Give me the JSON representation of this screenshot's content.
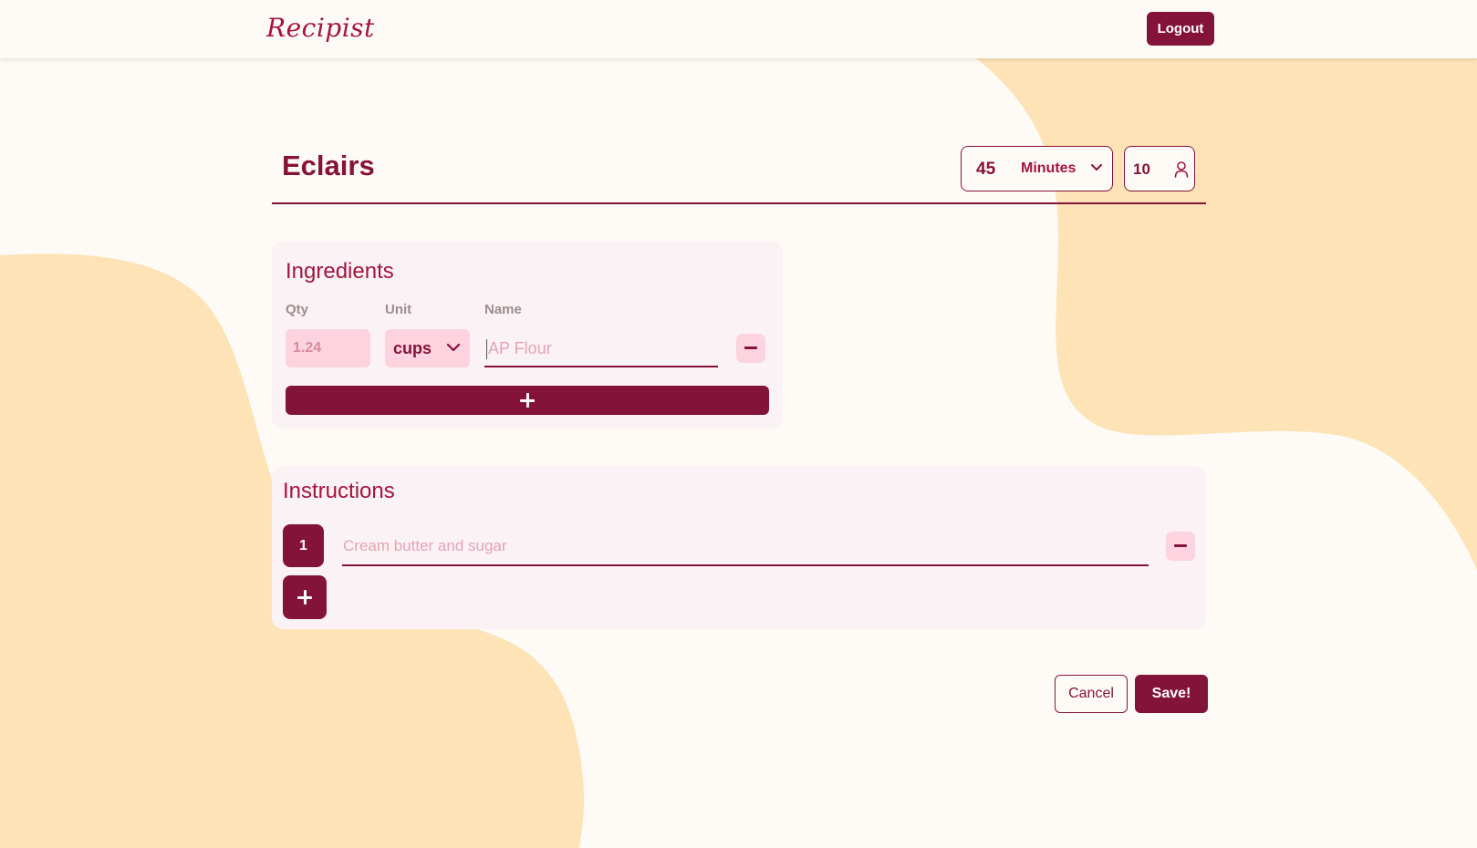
{
  "app": {
    "logo": "Recipist"
  },
  "header": {
    "logout_label": "Logout"
  },
  "recipe": {
    "title": "Eclairs",
    "time_value": "45",
    "time_unit": "Minutes",
    "servings": "10"
  },
  "ingredients": {
    "heading": "Ingredients",
    "columns": {
      "qty": "Qty",
      "unit": "Unit",
      "name": "Name"
    },
    "rows": [
      {
        "qty_placeholder": "1.24",
        "unit": "cups",
        "name_placeholder": "AP Flour"
      }
    ]
  },
  "instructions": {
    "heading": "Instructions",
    "steps": [
      {
        "number": "1",
        "placeholder": "Cream butter and sugar"
      }
    ]
  },
  "actions": {
    "cancel_label": "Cancel",
    "save_label": "Save!"
  },
  "colors": {
    "accent": "#841339",
    "background": "#fefbf6",
    "blob": "#fde3b6",
    "soft_pink": "#fcd3de"
  },
  "icons": [
    "chevron-down-icon",
    "user-icon",
    "minus-icon",
    "plus-icon"
  ]
}
